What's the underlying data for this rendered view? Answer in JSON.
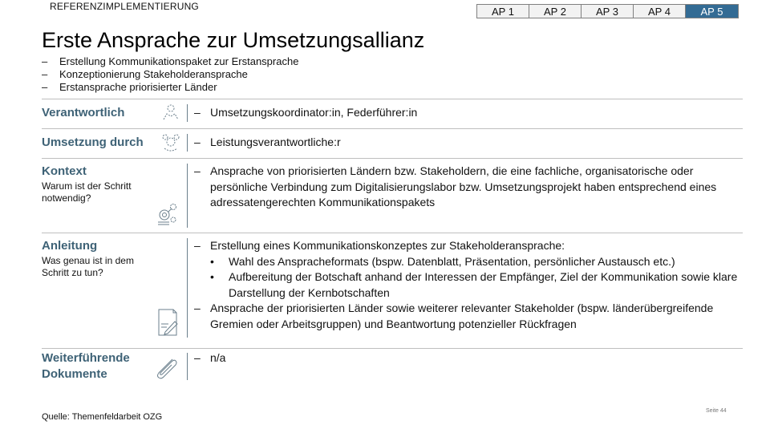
{
  "header": {
    "section_label": "REFERENZIMPLEMENTIERUNG",
    "tabs": [
      {
        "label": "AP 1",
        "active": false
      },
      {
        "label": "AP 2",
        "active": false
      },
      {
        "label": "AP 3",
        "active": false
      },
      {
        "label": "AP 4",
        "active": false
      },
      {
        "label": "AP 5",
        "active": true
      }
    ],
    "accent_color": "#336b94"
  },
  "title": "Erste Ansprache zur Umsetzungsallianz",
  "intro_items": [
    "Erstellung Kommunikationspaket zur Erstansprache",
    "Konzeptionierung Stakeholderansprache",
    "Erstansprache priorisierter Länder"
  ],
  "rows": {
    "verantwortlich": {
      "label": "Verantwortlich",
      "icon": "person-icon",
      "text": "Umsetzungskoordinator:in, Federführer:in"
    },
    "umsetzung": {
      "label": "Umsetzung durch",
      "icon": "team-icon",
      "text": "Leistungsverantwortliche:r"
    },
    "kontext": {
      "label": "Kontext",
      "sublabel": "Warum ist der Schritt notwendig?",
      "icon": "gears-icon",
      "text": "Ansprache von priorisierten Ländern bzw. Stakeholdern, die eine fachliche, organisatorische oder persönliche Verbindung zum Digitalisierungslabor bzw. Umsetzungsprojekt haben entsprechend eines adressatengerechten Kommunikationspakets"
    },
    "anleitung": {
      "label": "Anleitung",
      "sublabel": "Was genau ist in dem Schritt zu tun?",
      "icon": "document-edit-icon",
      "item1": "Erstellung eines Kommunikationskonzeptes zur Stakeholderansprache:",
      "bullets": [
        "Wahl des Anspracheformats (bspw. Datenblatt, Präsentation, persönlicher Austausch etc.)",
        "Aufbereitung der Botschaft anhand der Interessen der Empfänger, Ziel der Kommunikation sowie klare Darstellung der Kernbotschaften"
      ],
      "item2": "Ansprache der priorisierten Länder sowie weiterer relevanter Stakeholder (bspw. länderübergreifende Gremien oder Arbeitsgruppen) und Beantwortung potenzieller Rückfragen"
    },
    "dokumente": {
      "label": "Weiterführende Dokumente",
      "icon": "paperclip-icon",
      "text": "n/a"
    }
  },
  "footer": {
    "source": "Quelle: Themenfeldarbeit OZG",
    "page": "Seite 44"
  }
}
